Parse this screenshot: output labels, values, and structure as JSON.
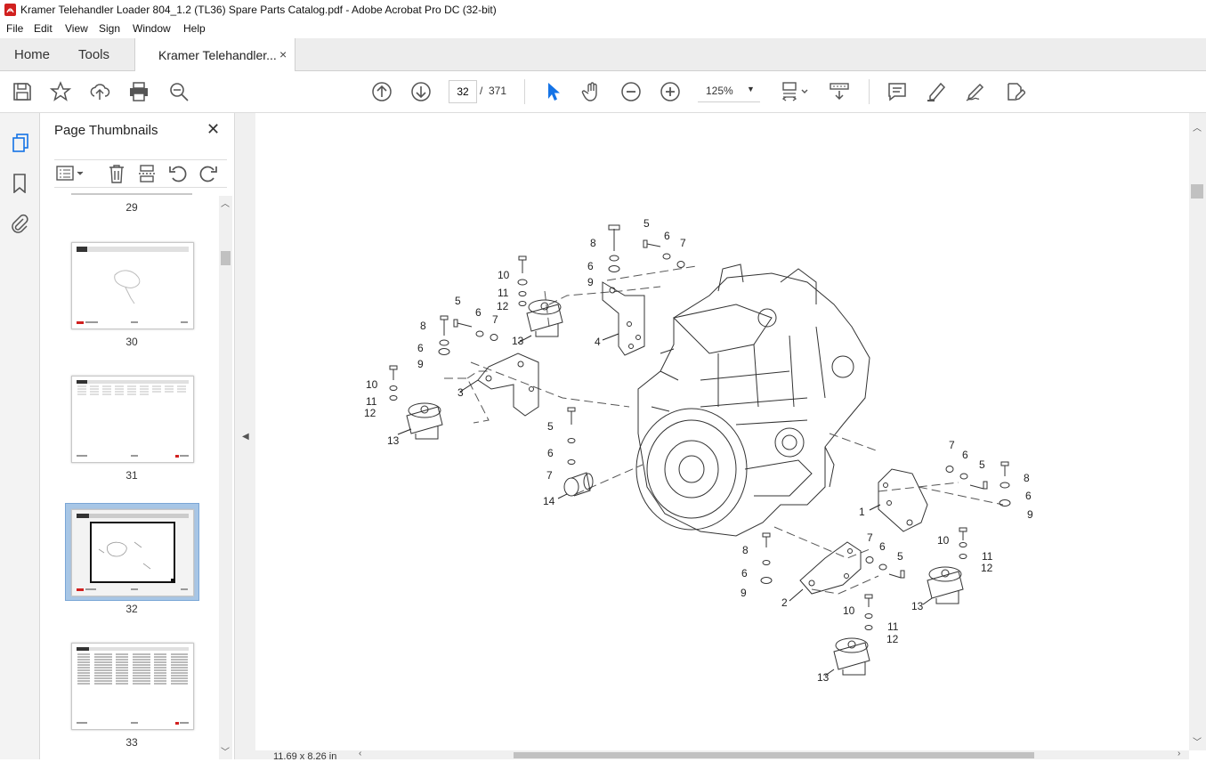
{
  "window": {
    "title": "Kramer Telehandler Loader 804_1.2 (TL36) Spare Parts Catalog.pdf - Adobe Acrobat Pro DC (32-bit)",
    "app_icon": "acrobat-logo-icon"
  },
  "menu": [
    "File",
    "Edit",
    "View",
    "Sign",
    "Window",
    "Help"
  ],
  "tabs": {
    "home": "Home",
    "tools": "Tools",
    "document": "Kramer Telehandler...",
    "close_glyph": "×"
  },
  "toolbar": {
    "page_current": "32",
    "page_separator": "/",
    "page_total": "371",
    "zoom": "125%",
    "icons_left": [
      "save-icon",
      "bookmark-star-icon",
      "upload-icon",
      "print-icon",
      "zoom-search-icon"
    ],
    "icons_nav": [
      "page-up-icon",
      "page-down-icon"
    ],
    "icons_tools": [
      "select-arrow-icon",
      "hand-icon",
      "zoom-out-icon",
      "zoom-in-icon"
    ],
    "icons_right": [
      "page-fit-icon",
      "scroll-mode-icon",
      "comment-icon",
      "highlight-icon",
      "sign-icon",
      "edit-pdf-icon"
    ]
  },
  "left_rail": [
    "page-thumbnails-icon",
    "bookmarks-icon",
    "attachments-icon"
  ],
  "thumbnails_panel": {
    "title": "Page Thumbnails",
    "close_glyph": "✕",
    "tools": [
      "options-menu-icon",
      "delete-page-icon",
      "insert-page-icon",
      "rotate-ccw-icon",
      "rotate-cw-icon"
    ],
    "pages": [
      {
        "number": "29",
        "selected": false
      },
      {
        "number": "30",
        "selected": false
      },
      {
        "number": "31",
        "selected": false
      },
      {
        "number": "32",
        "selected": true
      },
      {
        "number": "33",
        "selected": false
      }
    ]
  },
  "document": {
    "page_size": "11.69 x 8.26 in",
    "callouts": [
      "1",
      "2",
      "3",
      "4",
      "5",
      "6",
      "7",
      "8",
      "9",
      "10",
      "11",
      "12",
      "13",
      "14"
    ]
  },
  "colors": {
    "accent": "#1473e6",
    "selection": "#a7c6e6",
    "logo_red": "#d1201f"
  }
}
